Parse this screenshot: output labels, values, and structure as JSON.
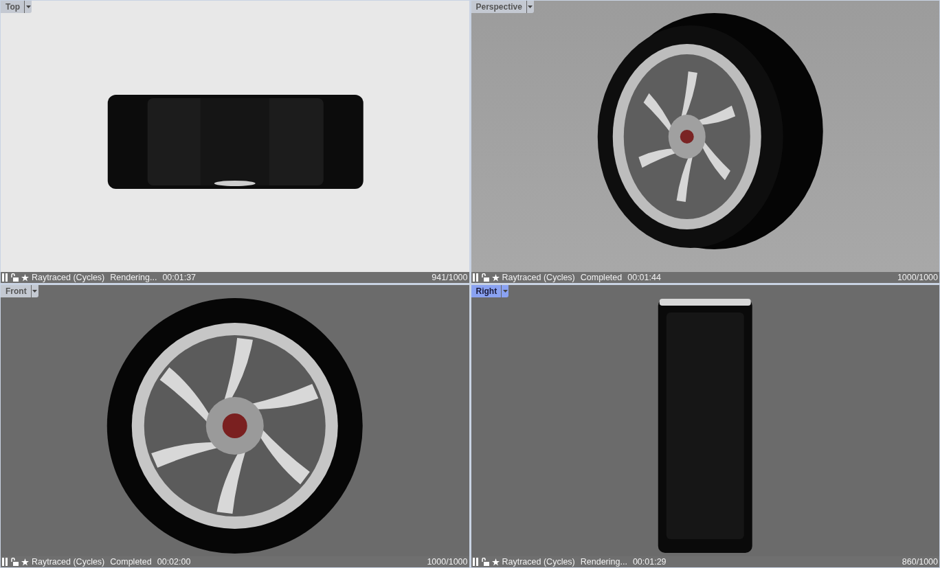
{
  "viewports": [
    {
      "name": "Top",
      "selected": false,
      "mode": "Raytraced (Cycles)",
      "status": "Rendering...",
      "time": "00:01:37",
      "passes": "941/1000"
    },
    {
      "name": "Perspective",
      "selected": false,
      "mode": "Raytraced (Cycles)",
      "status": "Completed",
      "time": "00:01:44",
      "passes": "1000/1000"
    },
    {
      "name": "Front",
      "selected": false,
      "mode": "Raytraced (Cycles)",
      "status": "Completed",
      "time": "00:02:00",
      "passes": "1000/1000"
    },
    {
      "name": "Right",
      "selected": true,
      "mode": "Raytraced (Cycles)",
      "status": "Rendering...",
      "time": "00:01:29",
      "passes": "860/1000"
    }
  ]
}
